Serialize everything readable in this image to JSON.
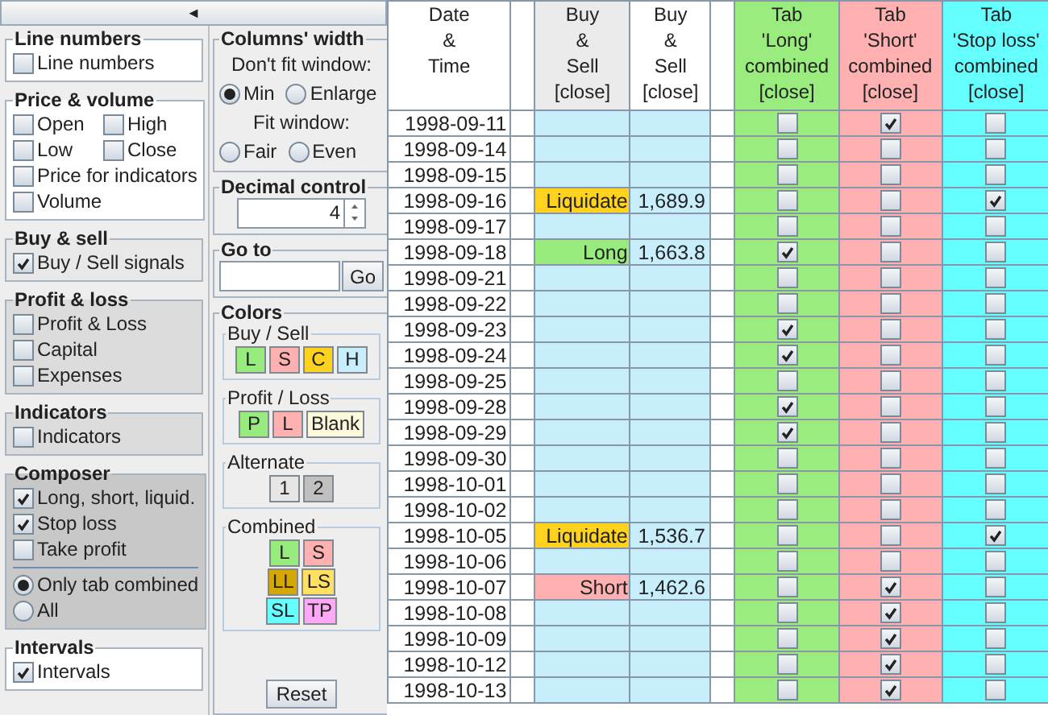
{
  "collapse_button": {
    "label": "◄"
  },
  "left_groups": [
    {
      "title": "Line numbers",
      "color": "#ffffff",
      "rows": [
        [
          {
            "kind": "checkbox",
            "label": "Line numbers",
            "checked": false
          }
        ]
      ]
    },
    {
      "title": "Price & volume",
      "color": "#ffffff",
      "rows": [
        [
          {
            "kind": "checkbox",
            "label": "Open",
            "checked": false
          },
          {
            "kind": "checkbox",
            "label": "High",
            "checked": false
          }
        ],
        [
          {
            "kind": "checkbox",
            "label": "Low",
            "checked": false
          },
          {
            "kind": "checkbox",
            "label": "Close",
            "checked": false
          }
        ],
        [
          {
            "kind": "checkbox",
            "label": "Price for indicators",
            "checked": false
          }
        ],
        [
          {
            "kind": "checkbox",
            "label": "Volume",
            "checked": false
          }
        ]
      ]
    },
    {
      "title": "Buy & sell",
      "color": "#e8e8e8",
      "rows": [
        [
          {
            "kind": "checkbox",
            "label": "Buy / Sell signals",
            "checked": true
          }
        ]
      ]
    },
    {
      "title": "Profit & loss",
      "color": "#dcdcdc",
      "rows": [
        [
          {
            "kind": "checkbox",
            "label": "Profit & Loss",
            "checked": false
          }
        ],
        [
          {
            "kind": "checkbox",
            "label": "Capital",
            "checked": false
          }
        ],
        [
          {
            "kind": "checkbox",
            "label": "Expenses",
            "checked": false
          }
        ]
      ]
    },
    {
      "title": "Indicators",
      "color": "#dcdcdc",
      "rows": [
        [
          {
            "kind": "checkbox",
            "label": "Indicators",
            "checked": false
          }
        ]
      ]
    },
    {
      "title": "Composer",
      "color": "#c8c8c8",
      "rows": [
        [
          {
            "kind": "checkbox",
            "label": "Long, short, liquid.",
            "checked": true
          }
        ],
        [
          {
            "kind": "checkbox",
            "label": "Stop loss",
            "checked": true
          }
        ],
        [
          {
            "kind": "checkbox",
            "label": "Take profit",
            "checked": false
          }
        ],
        [
          {
            "kind": "separator"
          }
        ],
        [
          {
            "kind": "radio",
            "label": "Only tab combined",
            "selected": true
          }
        ],
        [
          {
            "kind": "radio",
            "label": "All",
            "selected": false
          }
        ]
      ]
    },
    {
      "title": "Intervals",
      "color": "#ffffff",
      "rows": [
        [
          {
            "kind": "checkbox",
            "label": "Intervals",
            "checked": true
          }
        ]
      ]
    }
  ],
  "columns_width": {
    "title": "Columns' width",
    "sections": [
      {
        "caption": "Don't fit window:",
        "options": [
          {
            "label": "Min",
            "selected": true
          },
          {
            "label": "Enlarge",
            "selected": false
          }
        ]
      },
      {
        "caption": "Fit window:",
        "options": [
          {
            "label": "Fair",
            "selected": false
          },
          {
            "label": "Even",
            "selected": false
          }
        ]
      }
    ]
  },
  "decimal_control": {
    "title": "Decimal control",
    "value": "4"
  },
  "go_to": {
    "title": "Go to",
    "button": "Go"
  },
  "colors": {
    "title": "Colors",
    "groups": [
      {
        "title": "Buy / Sell",
        "rows": [
          [
            {
              "label": "L",
              "color": "#98ec7e"
            },
            {
              "label": "S",
              "color": "#ffb0b0"
            },
            {
              "label": "C",
              "color": "#ffd21f"
            },
            {
              "label": "H",
              "color": "#c8eefc"
            }
          ]
        ]
      },
      {
        "title": "Profit / Loss",
        "rows": [
          [
            {
              "label": "P",
              "color": "#98ec7e"
            },
            {
              "label": "L",
              "color": "#ffb0b0"
            },
            {
              "label": "Blank",
              "color": "#fcf8dc"
            }
          ]
        ]
      },
      {
        "title": "Alternate",
        "rows": [
          [
            {
              "label": "1",
              "color": "#e6e6e6"
            },
            {
              "label": "2",
              "color": "#c0c0c0"
            }
          ]
        ]
      },
      {
        "title": "Combined",
        "rows": [
          [
            {
              "label": "L",
              "color": "#98ec7e"
            },
            {
              "label": "S",
              "color": "#ffb0b0"
            }
          ],
          [
            {
              "label": "LL",
              "color": "#d4a800"
            },
            {
              "label": "LS",
              "color": "#ffe060"
            }
          ],
          [
            {
              "label": "SL",
              "color": "#66ffff"
            },
            {
              "label": "TP",
              "color": "#ffa8f8"
            }
          ]
        ]
      }
    ],
    "reset": "Reset"
  },
  "table": {
    "columns": [
      {
        "kind": "date",
        "label": "Date\n&\nTime"
      },
      {
        "kind": "spacer"
      },
      {
        "kind": "signal",
        "label": "Buy\n&\nSell\n[close]"
      },
      {
        "kind": "price",
        "label": "Buy\n&\nSell\n[close]"
      },
      {
        "kind": "spacer"
      },
      {
        "kind": "long",
        "label": "Tab\n'Long'\ncombined\n[close]"
      },
      {
        "kind": "short",
        "label": "Tab\n'Short'\ncombined\n[close]"
      },
      {
        "kind": "stop",
        "label": "Tab\n'Stop loss'\ncombined\n[close]"
      }
    ],
    "rows": [
      {
        "date": "1998-09-11",
        "long": false,
        "short": true,
        "stop": false
      },
      {
        "date": "1998-09-14",
        "long": false,
        "short": false,
        "stop": false
      },
      {
        "date": "1998-09-15",
        "long": false,
        "short": false,
        "stop": false
      },
      {
        "date": "1998-09-16",
        "signal": {
          "kind": "liquidate",
          "label": "Liquidate"
        },
        "price": "1,689.9",
        "long": false,
        "short": false,
        "stop": true
      },
      {
        "date": "1998-09-17",
        "long": false,
        "short": false,
        "stop": false
      },
      {
        "date": "1998-09-18",
        "signal": {
          "kind": "long",
          "label": "Long"
        },
        "price": "1,663.8",
        "long": true,
        "short": false,
        "stop": false
      },
      {
        "date": "1998-09-21",
        "long": false,
        "short": false,
        "stop": false
      },
      {
        "date": "1998-09-22",
        "long": false,
        "short": false,
        "stop": false
      },
      {
        "date": "1998-09-23",
        "long": true,
        "short": false,
        "stop": false
      },
      {
        "date": "1998-09-24",
        "long": true,
        "short": false,
        "stop": false
      },
      {
        "date": "1998-09-25",
        "long": false,
        "short": false,
        "stop": false
      },
      {
        "date": "1998-09-28",
        "long": true,
        "short": false,
        "stop": false
      },
      {
        "date": "1998-09-29",
        "long": true,
        "short": false,
        "stop": false
      },
      {
        "date": "1998-09-30",
        "long": false,
        "short": false,
        "stop": false
      },
      {
        "date": "1998-10-01",
        "long": false,
        "short": false,
        "stop": false
      },
      {
        "date": "1998-10-02",
        "long": false,
        "short": false,
        "stop": false
      },
      {
        "date": "1998-10-05",
        "signal": {
          "kind": "liquidate",
          "label": "Liquidate"
        },
        "price": "1,536.7",
        "long": false,
        "short": false,
        "stop": true
      },
      {
        "date": "1998-10-06",
        "long": false,
        "short": false,
        "stop": false
      },
      {
        "date": "1998-10-07",
        "signal": {
          "kind": "short",
          "label": "Short"
        },
        "price": "1,462.6",
        "long": false,
        "short": true,
        "stop": false
      },
      {
        "date": "1998-10-08",
        "long": false,
        "short": true,
        "stop": false
      },
      {
        "date": "1998-10-09",
        "long": false,
        "short": true,
        "stop": false
      },
      {
        "date": "1998-10-12",
        "long": false,
        "short": true,
        "stop": false
      },
      {
        "date": "1998-10-13",
        "long": false,
        "short": true,
        "stop": false
      }
    ]
  }
}
